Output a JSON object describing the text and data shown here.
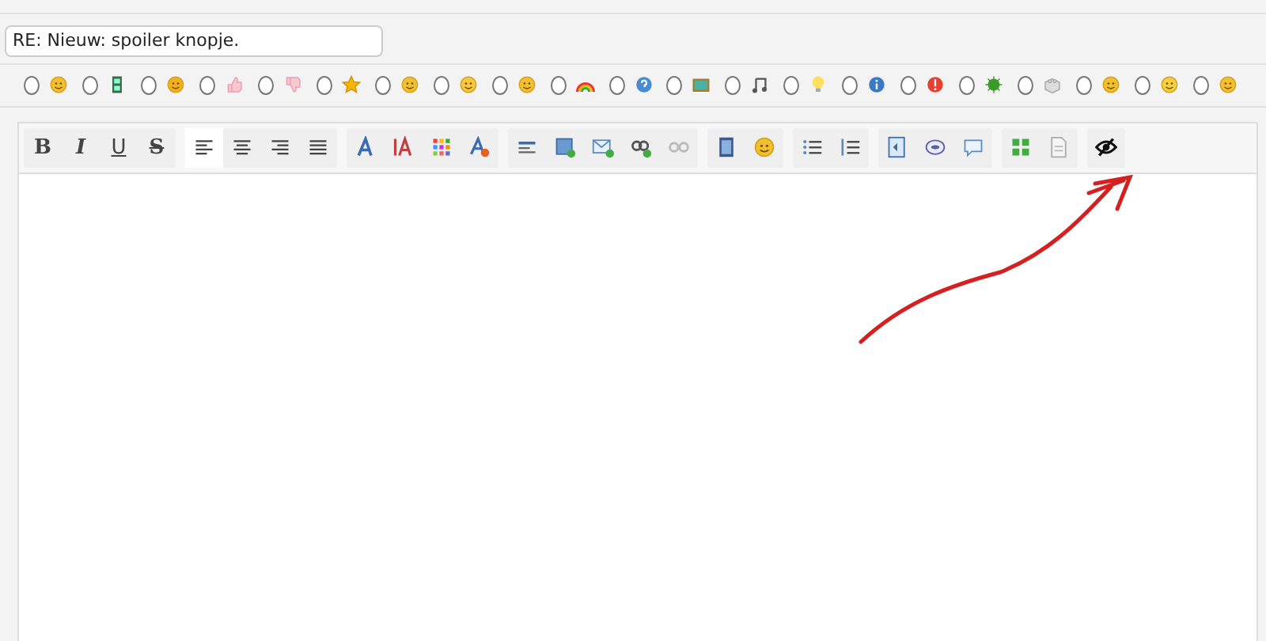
{
  "subject": {
    "value": "RE: Nieuw: spoiler knopje."
  },
  "post_icons": [
    {
      "selected": false
    },
    {
      "selected": false
    },
    {
      "selected": false
    },
    {
      "selected": false
    },
    {
      "selected": false
    },
    {
      "selected": false
    },
    {
      "selected": false
    },
    {
      "selected": false
    },
    {
      "selected": false
    },
    {
      "selected": false
    },
    {
      "selected": false
    },
    {
      "selected": false
    },
    {
      "selected": false
    },
    {
      "selected": false
    },
    {
      "selected": false
    },
    {
      "selected": false
    },
    {
      "selected": false
    },
    {
      "selected": false
    },
    {
      "selected": false
    },
    {
      "selected": false
    },
    {
      "selected": false
    }
  ],
  "toolbar": [
    {
      "buttons": [
        {
          "kind": "text",
          "label": "B",
          "active": false
        },
        {
          "kind": "text",
          "label": "I",
          "active": false
        },
        {
          "kind": "text",
          "label": "U",
          "active": false
        },
        {
          "kind": "text",
          "label": "S",
          "active": false
        }
      ]
    },
    {
      "buttons": [
        {
          "kind": "icon",
          "active": true
        },
        {
          "kind": "icon",
          "active": false
        },
        {
          "kind": "icon",
          "active": false
        },
        {
          "kind": "icon",
          "active": false
        }
      ]
    },
    {
      "buttons": [
        {
          "kind": "icon",
          "active": false
        },
        {
          "kind": "icon",
          "active": false
        },
        {
          "kind": "icon",
          "active": false
        },
        {
          "kind": "icon",
          "active": false
        }
      ]
    },
    {
      "buttons": [
        {
          "kind": "icon",
          "active": false
        },
        {
          "kind": "icon",
          "active": false
        },
        {
          "kind": "icon",
          "active": false
        },
        {
          "kind": "icon",
          "active": false
        },
        {
          "kind": "icon",
          "active": false
        }
      ]
    },
    {
      "buttons": [
        {
          "kind": "icon",
          "active": false
        },
        {
          "kind": "icon",
          "active": false
        }
      ]
    },
    {
      "buttons": [
        {
          "kind": "icon",
          "active": false
        },
        {
          "kind": "icon",
          "active": false
        }
      ]
    },
    {
      "buttons": [
        {
          "kind": "icon",
          "active": false
        },
        {
          "kind": "icon",
          "active": false
        },
        {
          "kind": "icon",
          "active": false
        }
      ]
    },
    {
      "buttons": [
        {
          "kind": "icon",
          "active": false
        },
        {
          "kind": "icon",
          "active": false
        }
      ]
    },
    {
      "buttons": [
        {
          "kind": "icon",
          "active": false
        }
      ]
    }
  ]
}
